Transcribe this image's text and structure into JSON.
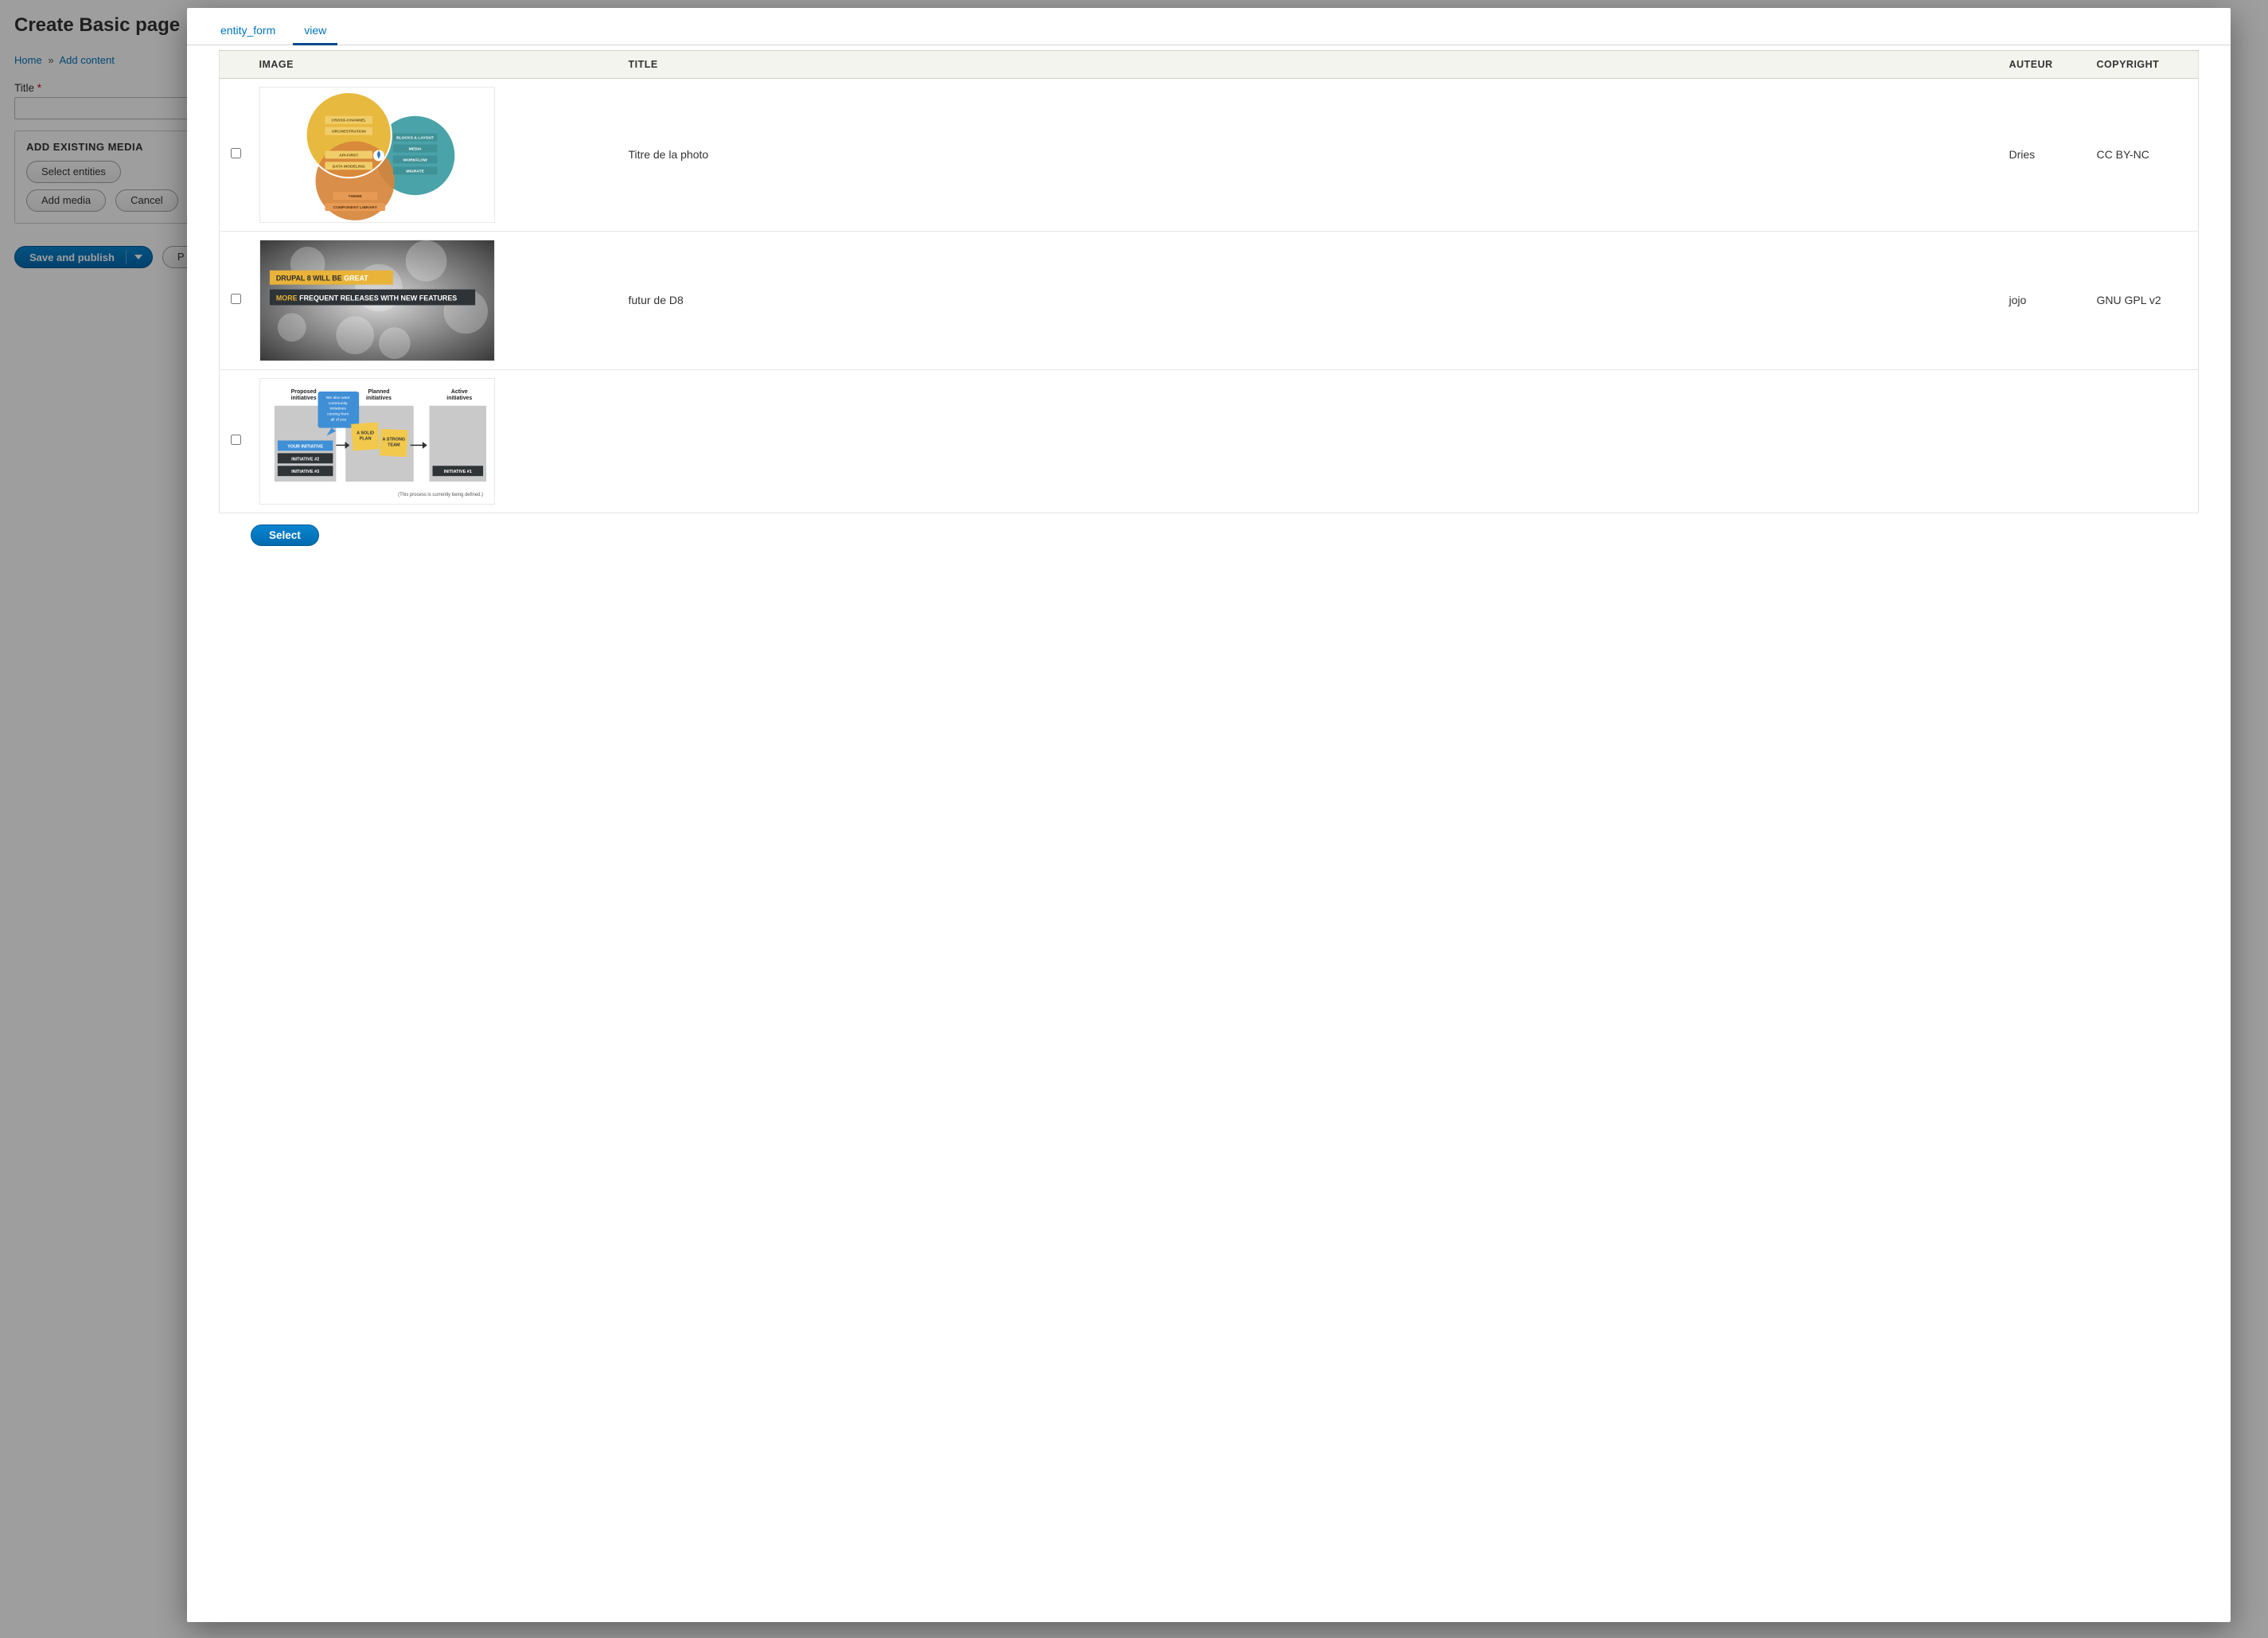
{
  "page": {
    "title": "Create Basic page",
    "breadcrumb": [
      {
        "label": "Home",
        "href": true
      },
      {
        "label": "Add content",
        "href": true
      }
    ],
    "title_field": {
      "label": "Title",
      "required": true,
      "value": ""
    },
    "media_fieldset": {
      "legend": "ADD EXISTING MEDIA",
      "select_entities": "Select entities",
      "add_media": "Add media",
      "cancel": "Cancel"
    },
    "actions": {
      "primary": "Save and publish",
      "secondary_prefix": "P"
    }
  },
  "modal": {
    "tabs": [
      {
        "id": "entity_form",
        "label": "entity_form",
        "active": false
      },
      {
        "id": "view",
        "label": "view",
        "active": true
      }
    ],
    "columns": {
      "image": "IMAGE",
      "title": "TITLE",
      "author": "AUTEUR",
      "copyright": "COPYRIGHT"
    },
    "rows": [
      {
        "title": "Titre de la photo",
        "author": "Dries",
        "copyright": "CC BY-NC"
      },
      {
        "title": "futur de D8",
        "author": "jojo",
        "copyright": "GNU GPL v2"
      },
      {
        "title": "",
        "author": "",
        "copyright": ""
      }
    ],
    "select_button": "Select"
  },
  "icons": {
    "caret_down": "caret-down-icon"
  },
  "thumb1": {
    "blocks_layout": "BLOCKS & LAYOUT",
    "media": "MEDIA",
    "workflow": "WORKFLOW",
    "migrate": "MIGRATE",
    "cross_channel": "CROSS-CHANNEL",
    "orchestration": "ORCHESTRATION",
    "api_first": "API-FIRST",
    "data_modeling": "DATA MODELING",
    "theme": "THEME",
    "component_library": "COMPONENT LIBRARY"
  },
  "thumb2": {
    "line1_a": "DRUPAL 8 WILL BE ",
    "line1_b": "GREAT",
    "line2_a": "MORE ",
    "line2_b": "FREQUENT ",
    "line2_c": "RELEASES WITH NEW FEATURES"
  },
  "thumb3": {
    "col1": "Proposed\ninitiatives",
    "col2": "Planned\ninitiatives",
    "col3": "Active\ninitiatives",
    "bubble": "We also want\ncommunity\ninitiatives\ncoming from\nall of you",
    "your_initiative": "YOUR INITIATIVE",
    "initiative2": "INITIATIVE #2",
    "initiative3": "INITIATIVE #3",
    "solid_plan": "A SOLID\nPLAN",
    "strong_team": "A STRONG\nTEAM",
    "initiative1": "INITIATIVE #1",
    "footnote": "(This process is currently being defined.)"
  }
}
